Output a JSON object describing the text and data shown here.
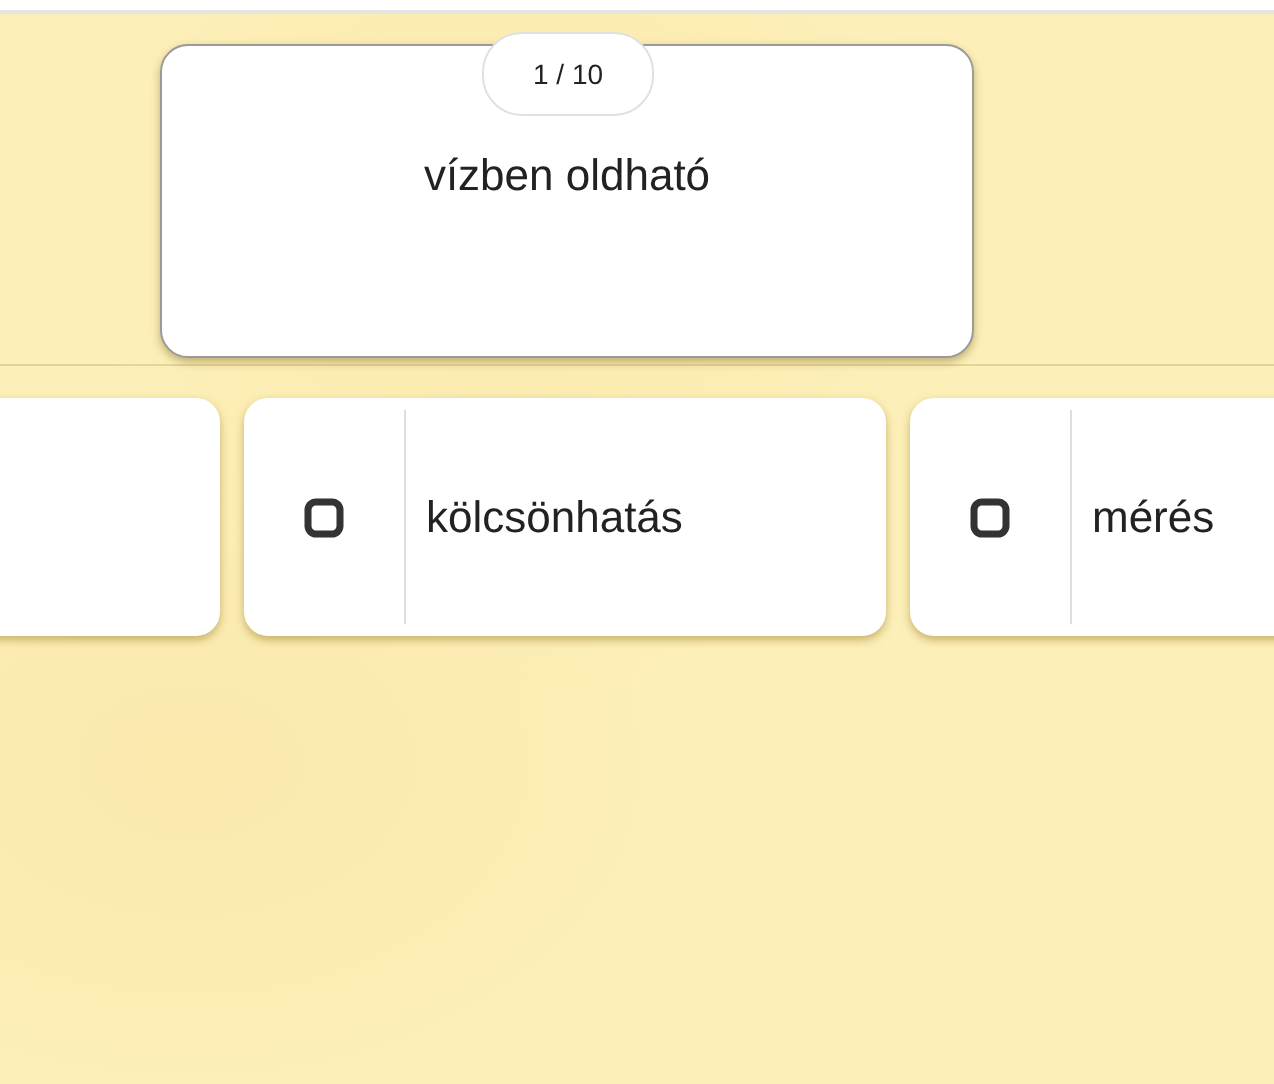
{
  "question": {
    "counter": "1 / 10",
    "prompt": "vízben oldható"
  },
  "options": [
    {
      "kind": "partial"
    },
    {
      "kind": "full",
      "label": "kölcsönhatás",
      "checked": false
    },
    {
      "kind": "full",
      "label": "mérés",
      "checked": false
    }
  ]
}
